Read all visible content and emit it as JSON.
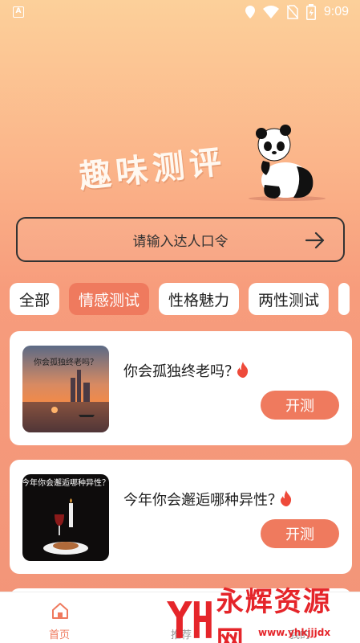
{
  "status_bar": {
    "app_icon": "A",
    "time": "9:09"
  },
  "hero": {
    "title": "趣味测评"
  },
  "code_input": {
    "placeholder": "请输入达人口令"
  },
  "tabs": [
    {
      "label": "全部",
      "active": false
    },
    {
      "label": "情感测试",
      "active": true
    },
    {
      "label": "性格魅力",
      "active": false
    },
    {
      "label": "两性测试",
      "active": false
    }
  ],
  "cards": [
    {
      "title": "你会孤独终老吗？",
      "thumb_text": "你会孤独终老吗？",
      "button": "开测"
    },
    {
      "title": "今年你会邂逅哪种异性？",
      "thumb_text": "今年你会邂逅哪种异性？",
      "button": "开测"
    }
  ],
  "bottom_nav": [
    {
      "label": "首页",
      "active": true
    },
    {
      "label": "推荐",
      "active": false
    },
    {
      "label": "我的",
      "active": false
    }
  ],
  "watermark": {
    "text": "永辉资源网",
    "url": "www.yhkjjjdx"
  },
  "colors": {
    "accent": "#ef7a5e",
    "watermark": "#e5252a"
  }
}
